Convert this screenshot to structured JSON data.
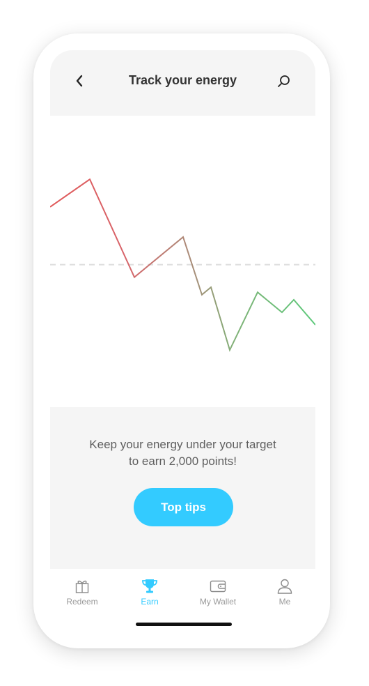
{
  "header": {
    "title": "Track your energy",
    "back_icon": "chevron-left-icon",
    "search_icon": "search-icon"
  },
  "chart_data": {
    "type": "line",
    "title": "",
    "xlabel": "",
    "ylabel": "",
    "grid": false,
    "legend": "none",
    "x": [
      0,
      1,
      2,
      3,
      4,
      5,
      6,
      7,
      8,
      9,
      10,
      11
    ],
    "series": [
      {
        "values": [
          0.72,
          0.83,
          0.44,
          0.6,
          0.37,
          0.4,
          0.15,
          0.38,
          0.3,
          0.35,
          0.25
        ]
      }
    ],
    "target": 0.49,
    "target_style": "dashed",
    "line_gradient": [
      "#e05656",
      "#5cc97a"
    ]
  },
  "panel": {
    "message_line1": "Keep your energy under your target",
    "message_line2": "to earn 2,000 points!",
    "cta_label": "Top tips"
  },
  "tabs": [
    {
      "label": "Redeem",
      "icon": "gift-icon",
      "active": false
    },
    {
      "label": "Earn",
      "icon": "trophy-icon",
      "active": true
    },
    {
      "label": "My Wallet",
      "icon": "wallet-icon",
      "active": false
    },
    {
      "label": "Me",
      "icon": "person-icon",
      "active": false
    }
  ],
  "colors": {
    "accent": "#33cbff",
    "panel_bg": "#f5f5f5",
    "line_start": "#e05656",
    "line_end": "#5cc97a",
    "target_line": "#dddddd"
  }
}
